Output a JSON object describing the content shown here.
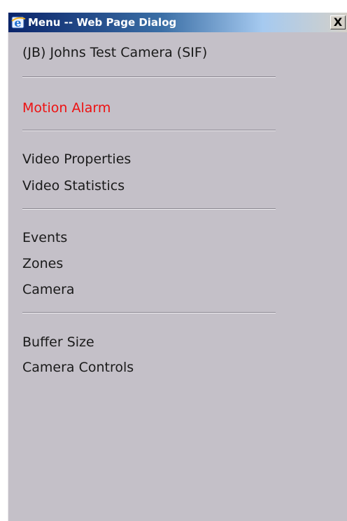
{
  "window": {
    "title": "Menu -- Web Page Dialog",
    "close_label": "X"
  },
  "menu": {
    "camera_title": "(JB) Johns Test Camera (SIF)",
    "motion_alarm": "Motion Alarm",
    "video_properties": "Video Properties",
    "video_statistics": "Video Statistics",
    "events": "Events",
    "zones": "Zones",
    "camera": "Camera",
    "buffer_size": "Buffer Size",
    "camera_controls": "Camera Controls"
  },
  "colors": {
    "alarm": "#ee1111",
    "background": "#c4c0c8",
    "text": "#1a1a1a"
  }
}
